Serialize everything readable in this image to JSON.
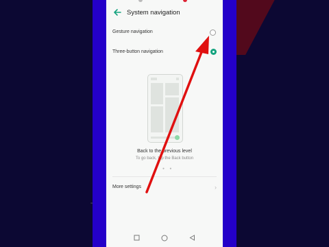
{
  "screen": {
    "title": "System navigation",
    "options": [
      {
        "label": "Gesture navigation",
        "selected": false
      },
      {
        "label": "Three-button navigation",
        "selected": true
      }
    ],
    "caption": {
      "title": "Back to the previous level",
      "subtitle": "To go back, tap the Back button"
    },
    "more_settings": "More settings",
    "nav_bar": [
      "recents-square",
      "home-circle",
      "back-triangle"
    ]
  },
  "colors": {
    "accent": "#14a37f",
    "side_bars": "#2400c9",
    "arrow": "#e01010"
  }
}
